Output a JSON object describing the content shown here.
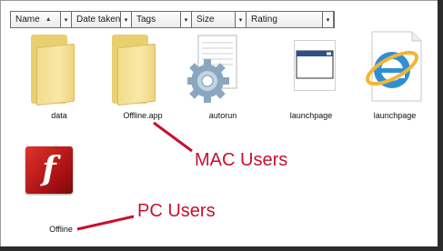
{
  "columns": [
    {
      "label": "Name",
      "sort_glyph": "▲"
    },
    {
      "label": "Date taken"
    },
    {
      "label": "Tags"
    },
    {
      "label": "Size"
    },
    {
      "label": "Rating"
    }
  ],
  "dropdown_glyph": "▾",
  "items": [
    {
      "label": "data",
      "icon": "folder-icon"
    },
    {
      "label": "Offline.app",
      "icon": "folder-icon"
    },
    {
      "label": "autorun",
      "icon": "gear-settings-icon"
    },
    {
      "label": "launchpage",
      "icon": "application-window-icon"
    },
    {
      "label": "launchpage",
      "icon": "internet-explorer-icon"
    },
    {
      "label": "Offline",
      "icon": "flash-icon"
    }
  ],
  "flash_glyph": "f",
  "annotations": {
    "mac": "MAC Users",
    "pc": "PC Users"
  },
  "colors": {
    "annotation": "#c8102e",
    "folder": "#f2dc8c",
    "flash": "#c0201d"
  }
}
